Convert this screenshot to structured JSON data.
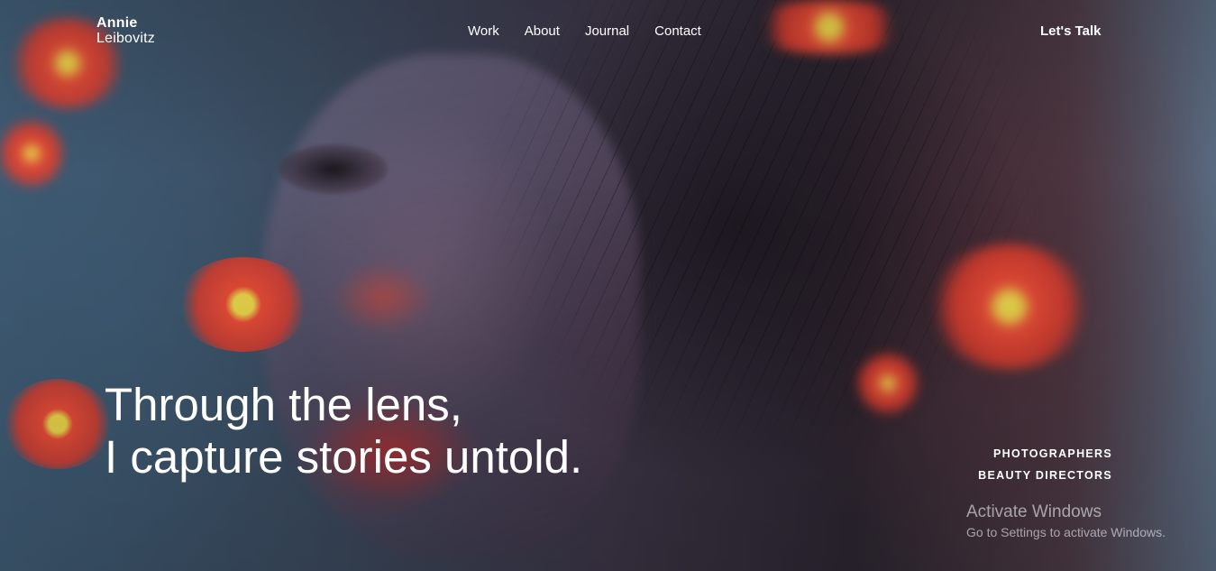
{
  "brand": {
    "line1": "Annie",
    "line2": "Leibovitz"
  },
  "nav": {
    "items": [
      "Work",
      "About",
      "Journal",
      "Contact"
    ]
  },
  "cta": {
    "label": "Let's Talk"
  },
  "hero": {
    "headline_line1": "Through the lens,",
    "headline_line2": "I capture stories untold.",
    "roles": [
      "PHOTOGRAPHERS",
      "BEAUTY DIRECTORS"
    ]
  },
  "windows_watermark": {
    "title": "Activate Windows",
    "subtitle": "Go to Settings to activate Windows."
  }
}
